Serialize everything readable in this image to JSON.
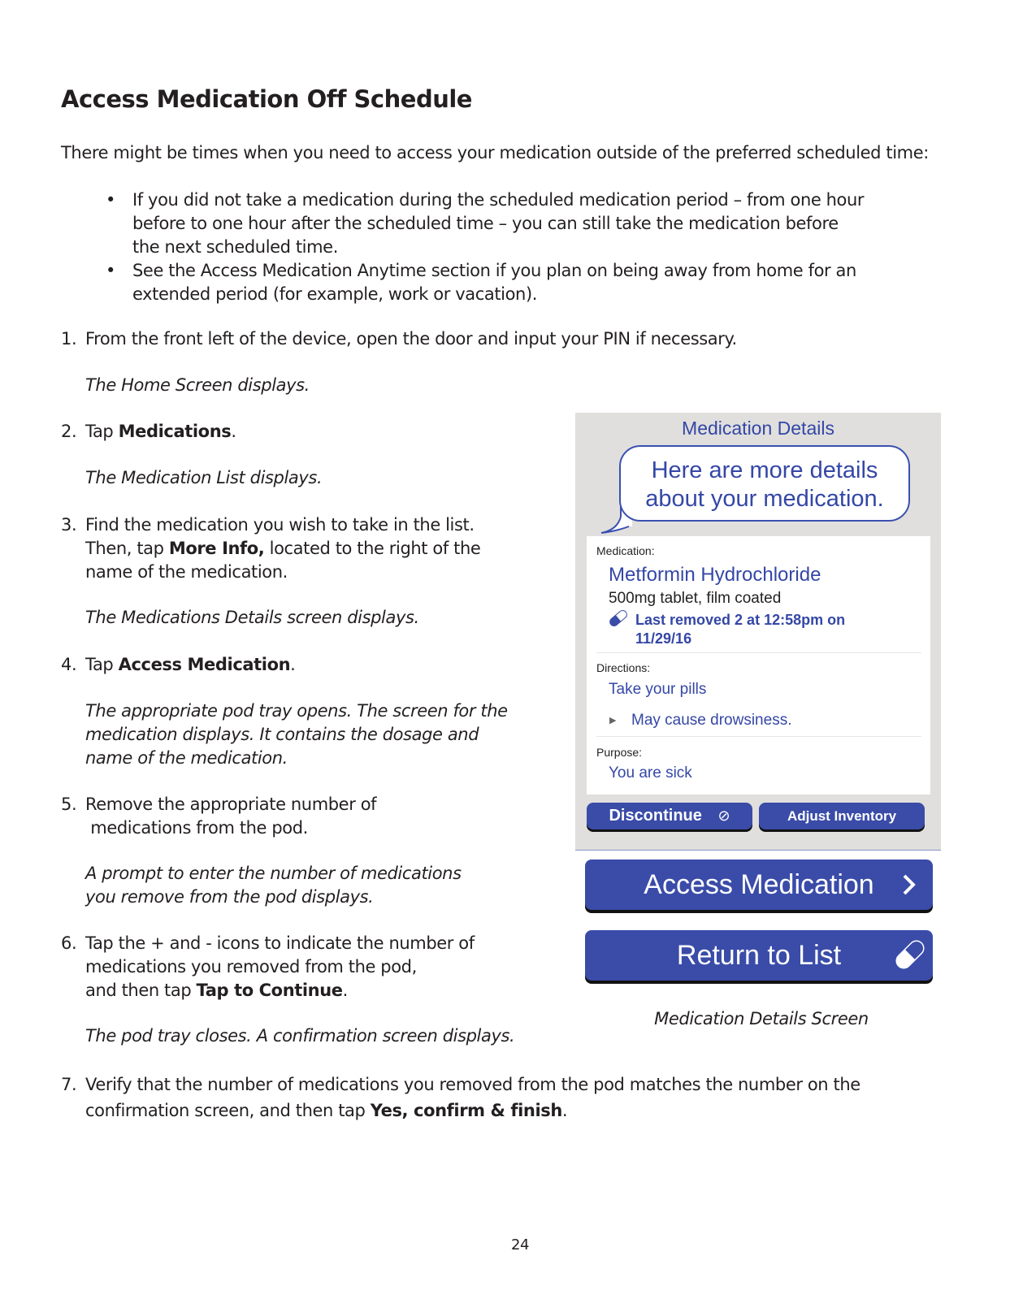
{
  "document": {
    "title": "Access Medication Off Schedule",
    "intro": "There might be times when you need to access your medication outside of the preferred scheduled time:",
    "bullets": [
      {
        "lines": [
          "If you did not take a medication during the scheduled medication period – from one hour",
          "before to one hour after the scheduled time – you can still take the medication before",
          "the next scheduled time."
        ]
      },
      {
        "lines": [
          "See the Access Medication Anytime section if you plan on being away from home for an",
          "extended period (for example, work or vacation)."
        ]
      }
    ],
    "bullet_glyph": "•",
    "steps": [
      {
        "num": "1.",
        "text": "From the front left of the device, open the door and input your PIN if necessary.",
        "note": "The Home Screen displays."
      },
      {
        "num": "2.",
        "pre": "Tap ",
        "bold": "Medications",
        "post": ".",
        "note": "The Medication List displays."
      },
      {
        "num": "3.",
        "line1": "Find the medication you wish to take in the list.",
        "pre": "Then, tap ",
        "bold": "More Info,",
        "post": " located to the right of the",
        "line3": "name of the medication.",
        "note": "The Medications Details screen displays."
      },
      {
        "num": "4.",
        "pre": "Tap ",
        "bold": "Access Medication",
        "post": ".",
        "note_lines": [
          "The appropriate pod tray opens. The screen for the",
          "medication displays.  It contains the dosage and",
          "name of the medication."
        ]
      },
      {
        "num": "5.",
        "line1": "Remove the appropriate number of",
        "line2": " medications from the pod.",
        "note_lines": [
          "A prompt to enter the number of medications",
          "you remove from the pod displays."
        ]
      },
      {
        "num": "6.",
        "line1": "Tap the + and - icons to indicate the number of",
        "line2": "medications you removed from the pod,",
        "pre": "and then tap ",
        "bold": "Tap to Continue",
        "post": ".",
        "note": "The pod tray closes. A confirmation screen displays."
      },
      {
        "num": "7.",
        "line1": "Verify that the number of medications you removed from the pod matches the number on the",
        "pre": "confirmation screen, and then tap ",
        "bold": "Yes, confirm & finish",
        "post": "."
      }
    ],
    "page_number": "24"
  },
  "device_screen": {
    "header": "Medication Details",
    "bubble_lines": [
      "Here are more details",
      "about your medication."
    ],
    "medication_label": "Medication:",
    "medication_name": "Metformin Hydrochloride",
    "medication_form": "500mg tablet, film coated",
    "last_removed_lines": [
      "Last removed 2 at 12:58pm on",
      "11/29/16"
    ],
    "directions_label": "Directions:",
    "directions": "Take your pills",
    "warning": "May cause drowsiness.",
    "purpose_label": "Purpose:",
    "purpose": "You are sick",
    "discontinue_button": "Discontinue",
    "adjust_inventory_button": "Adjust Inventory",
    "access_medication_button": "Access Medication",
    "return_to_list_button": "Return to List",
    "icons": {
      "pill": "pill-capsule-icon",
      "discontinue": "no-entry-icon",
      "expand": "triangle-right-icon",
      "next": "chevron-right-icon"
    },
    "colors": {
      "primary": "#3a4ca8",
      "panel_bg": "#e0dfdd",
      "text_blue": "#3447a6"
    }
  },
  "caption": "Medication Details Screen"
}
